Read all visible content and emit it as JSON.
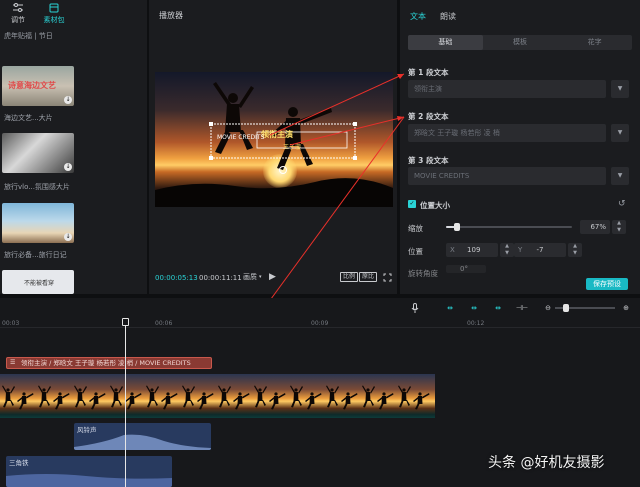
{
  "left_panel": {
    "tabs": [
      {
        "label": "调节",
        "icon": "sliders-icon"
      },
      {
        "label": "素材包",
        "icon": "package-icon"
      }
    ],
    "breadcrumb": "虎年贴福 | 节日",
    "items": [
      {
        "caption": "海边文艺...大片",
        "thumb_text": "诗意海边文艺"
      },
      {
        "caption": "旅行vlo...氛围感大片",
        "thumb_text": ""
      },
      {
        "caption": "旅行必备...旅行日记",
        "thumb_text": ""
      },
      {
        "caption": "",
        "thumb_text": "不能被看穿"
      }
    ]
  },
  "player": {
    "title": "播放器",
    "current_time": "00:00:05:13",
    "total_time": "00:00:11:11",
    "quality_label": "画质",
    "ratio_label": "比例",
    "original_label": "原比",
    "overlay_text": "领衔主演",
    "overlay_sub": "王子璇",
    "overlay_en": "MOVIE CREDITS"
  },
  "right_panel": {
    "tabs": [
      "文本",
      "朗读"
    ],
    "segments": [
      "基础",
      "模板",
      "花字"
    ],
    "paragraphs": [
      {
        "label": "第 1 段文本",
        "value": "领衔主演"
      },
      {
        "label": "第 2 段文本",
        "value": "郑晗文 王子璇 杨若彤 凌 梢"
      },
      {
        "label": "第 3 段文本",
        "value": "MOVIE CREDITS"
      }
    ],
    "position_size_label": "位置大小",
    "scale_label": "缩放",
    "scale_value": "67%",
    "scale_fraction": 0.67,
    "position_label": "位置",
    "x_label": "X",
    "x_value": "109",
    "y_label": "Y",
    "y_value": "-7",
    "rotate_label": "旋转角度",
    "rotate_value": "0°",
    "save_label": "保存预设"
  },
  "timeline": {
    "ticks": [
      "00:03",
      "00:06",
      "00:09",
      "00:12"
    ],
    "text_clip": "领衔主演 / 郑晗文 王子璇 杨若彤 凌 梢 / MOVIE CREDITS",
    "audio_clips": [
      {
        "label": "风铃声"
      },
      {
        "label": "三角铁"
      }
    ]
  },
  "watermark": "头条 @好机友摄影",
  "colors": {
    "accent": "#2ad3d6",
    "text_clip": "#8a3a33",
    "save_button": "#19b9c4",
    "audio_clip": "#283a5f"
  }
}
